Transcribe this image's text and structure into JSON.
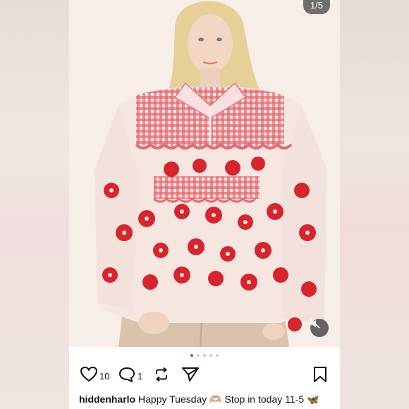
{
  "post": {
    "image_counter": "1/5",
    "like_count": "10",
    "comment_count": "1",
    "username": "hiddenharlo",
    "caption_text": "Happy Tuesday 🫶🏼 Stop in today 11-5 🦋",
    "carousel": {
      "total": 5,
      "active_index": 0
    }
  },
  "icons": {
    "mute": "speaker-muted-icon",
    "like": "heart-icon",
    "comment": "comment-bubble-icon",
    "repost": "repost-icon",
    "share": "paper-plane-icon",
    "save": "bookmark-icon"
  },
  "colors": {
    "accent_dot": "#3b6fd8",
    "garment_red": "#d8242c",
    "fleece": "#f5e6e0"
  }
}
